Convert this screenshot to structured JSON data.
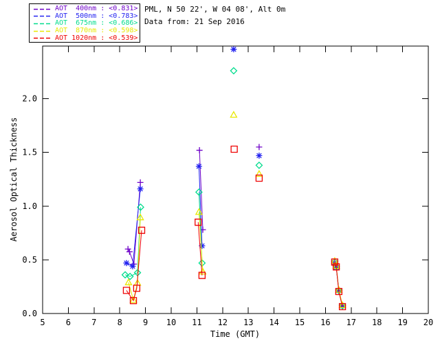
{
  "header": {
    "line1": "PML, N 50 22', W 04 08', Alt 0m",
    "line2": "Data from: 21 Sep 2016"
  },
  "legend": {
    "items": [
      {
        "label": "AOT  400nm : <0.831>",
        "color": "#6E00C8",
        "symbol": "plus-icon"
      },
      {
        "label": "AOT  500nm : <0.783>",
        "color": "#2222F0",
        "symbol": "asterisk-icon"
      },
      {
        "label": "AOT  675nm : <0.686>",
        "color": "#00DC8C",
        "symbol": "diamond-icon"
      },
      {
        "label": "AOT  870nm : <0.598>",
        "color": "#E8E800",
        "symbol": "triangle-icon"
      },
      {
        "label": "AOT 1020nm : <0.539>",
        "color": "#EE0000",
        "symbol": "square-icon"
      }
    ]
  },
  "chart_data": {
    "type": "line",
    "title": "",
    "xlabel": "Time (GMT)",
    "ylabel": "Aerosol Optical Thickness",
    "xlim": [
      5,
      20
    ],
    "ylim": [
      0,
      2.49
    ],
    "xticks": [
      5,
      6,
      7,
      8,
      9,
      10,
      11,
      12,
      13,
      14,
      15,
      16,
      17,
      18,
      19,
      20
    ],
    "yticks": [
      0.0,
      0.5,
      1.0,
      1.5,
      2.0
    ],
    "grid": false,
    "legend_position": "top-left",
    "series": [
      {
        "name": "AOT 400nm",
        "mean": 0.831,
        "color": "#6E00C8",
        "symbol": "plus",
        "segments": [
          [
            [
              8.32,
              0.6
            ],
            [
              8.38,
              0.575
            ],
            [
              8.55,
              0.46
            ],
            [
              8.8,
              1.22
            ]
          ],
          [
            [
              11.1,
              1.52
            ],
            [
              11.23,
              0.78
            ]
          ],
          [
            [
              13.42,
              1.55
            ]
          ],
          [
            [
              16.36,
              0.475
            ],
            [
              16.42,
              0.43
            ],
            [
              16.52,
              0.21
            ],
            [
              16.66,
              0.068
            ]
          ]
        ]
      },
      {
        "name": "AOT 500nm",
        "mean": 0.783,
        "color": "#2222F0",
        "symbol": "asterisk",
        "segments": [
          [
            [
              8.26,
              0.47
            ],
            [
              8.5,
              0.44
            ],
            [
              8.8,
              1.16
            ]
          ],
          [
            [
              11.08,
              1.37
            ],
            [
              11.2,
              0.63
            ]
          ],
          [
            [
              12.43,
              2.46
            ]
          ],
          [
            [
              13.42,
              1.47
            ]
          ],
          [
            [
              16.36,
              0.476
            ],
            [
              16.42,
              0.431
            ],
            [
              16.52,
              0.212
            ],
            [
              16.66,
              0.07
            ]
          ]
        ]
      },
      {
        "name": "AOT 675nm",
        "mean": 0.686,
        "color": "#00DC8C",
        "symbol": "diamond",
        "segments": [
          [
            [
              8.21,
              0.36
            ],
            [
              8.4,
              0.345
            ],
            [
              8.69,
              0.38
            ],
            [
              8.81,
              0.99
            ]
          ],
          [
            [
              11.08,
              1.13
            ],
            [
              11.2,
              0.47
            ]
          ],
          [
            [
              12.43,
              2.26
            ]
          ],
          [
            [
              13.42,
              1.38
            ]
          ],
          [
            [
              16.36,
              0.482
            ],
            [
              16.42,
              0.437
            ],
            [
              16.52,
              0.215
            ],
            [
              16.66,
              0.072
            ]
          ]
        ]
      },
      {
        "name": "AOT 870nm",
        "mean": 0.598,
        "color": "#E8E800",
        "symbol": "triangle",
        "segments": [
          [
            [
              8.34,
              0.29
            ],
            [
              8.53,
              0.125
            ],
            [
              8.69,
              0.285
            ],
            [
              8.8,
              0.895
            ]
          ],
          [
            [
              11.08,
              0.945
            ],
            [
              11.23,
              0.39
            ]
          ],
          [
            [
              12.43,
              1.85
            ]
          ],
          [
            [
              13.42,
              1.3
            ]
          ],
          [
            [
              16.36,
              0.49
            ],
            [
              16.42,
              0.443
            ],
            [
              16.52,
              0.22
            ],
            [
              16.66,
              0.078
            ]
          ]
        ]
      },
      {
        "name": "AOT 1020nm",
        "mean": 0.539,
        "color": "#EE0000",
        "symbol": "square",
        "segments": [
          [
            [
              8.26,
              0.215
            ],
            [
              8.53,
              0.12
            ],
            [
              8.66,
              0.235
            ],
            [
              8.85,
              0.775
            ]
          ],
          [
            [
              11.05,
              0.85
            ],
            [
              11.2,
              0.355
            ]
          ],
          [
            [
              12.45,
              1.53
            ]
          ],
          [
            [
              13.42,
              1.26
            ]
          ],
          [
            [
              16.36,
              0.479
            ],
            [
              16.42,
              0.434
            ],
            [
              16.52,
              0.205
            ],
            [
              16.66,
              0.064
            ]
          ]
        ]
      }
    ]
  }
}
